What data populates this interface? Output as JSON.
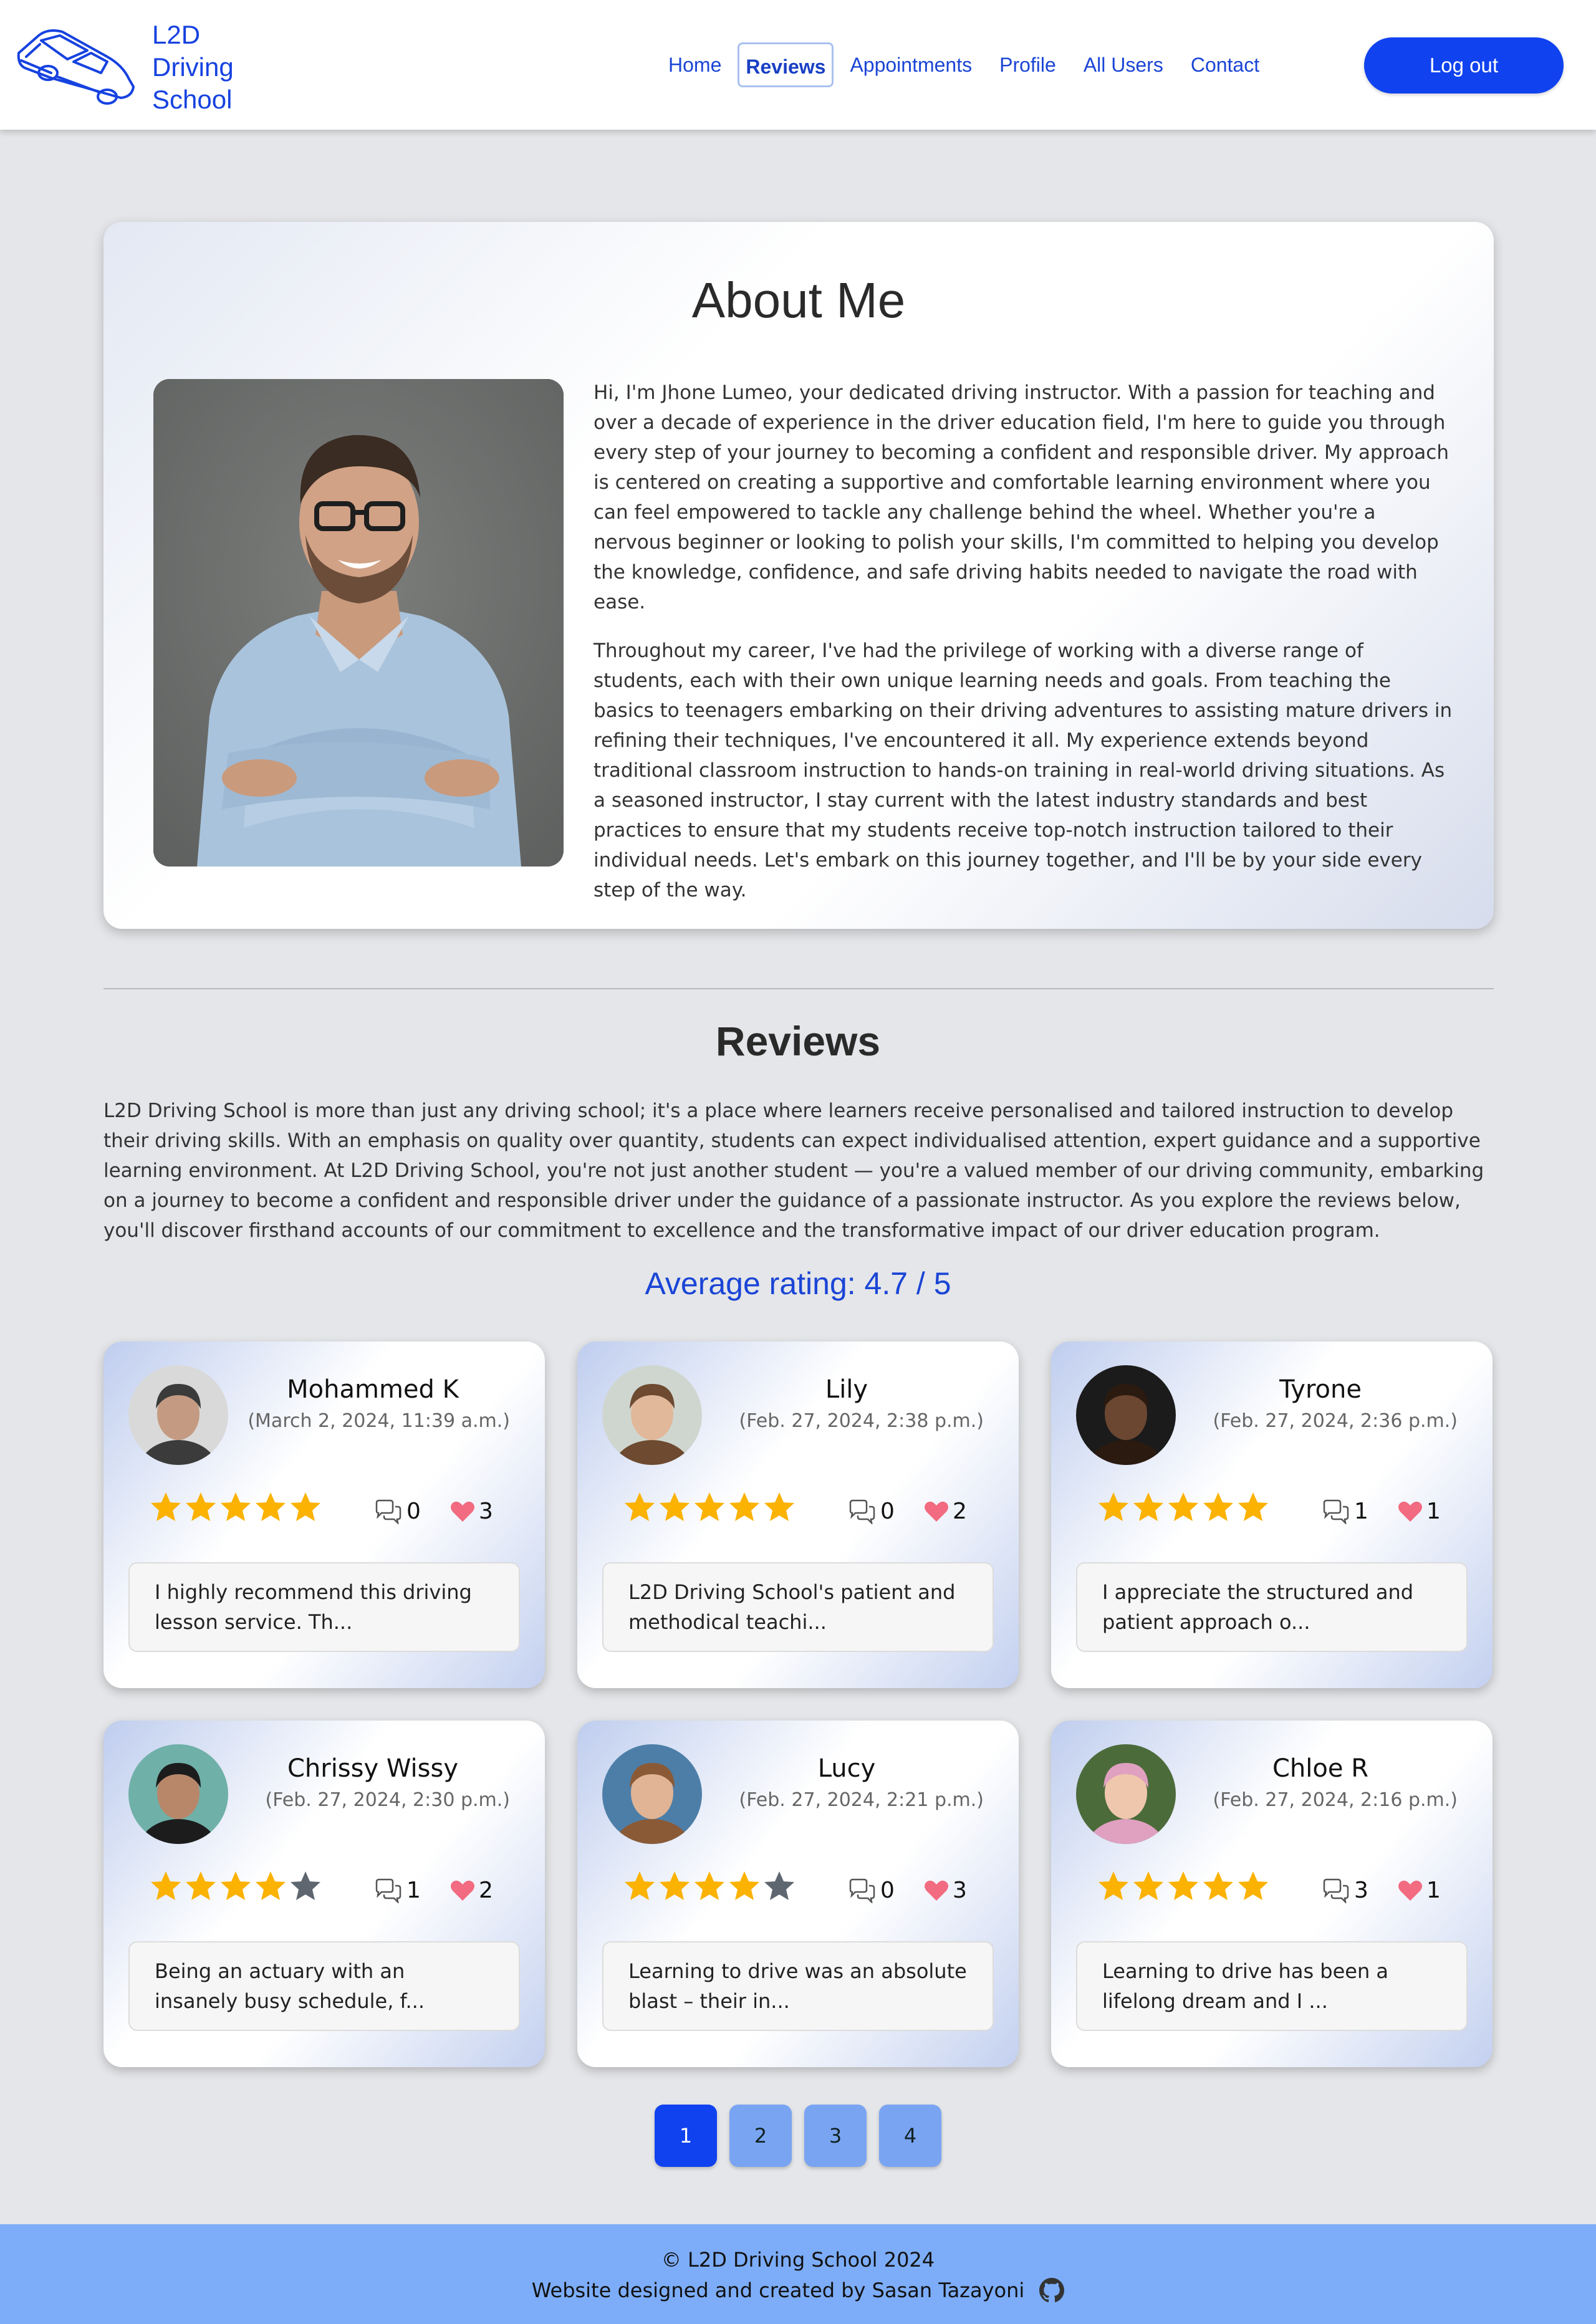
{
  "brand": {
    "line1": "L2D",
    "line2": "Driving",
    "line3": "School"
  },
  "nav": {
    "items": [
      {
        "label": "Home"
      },
      {
        "label": "Reviews"
      },
      {
        "label": "Appointments"
      },
      {
        "label": "Profile"
      },
      {
        "label": "All Users"
      },
      {
        "label": "Contact"
      }
    ],
    "logout_label": "Log out"
  },
  "about": {
    "title": "About Me",
    "paragraph1": "Hi, I'm Jhone Lumeo, your dedicated driving instructor. With a passion for teaching and over a decade of experience in the driver education field, I'm here to guide you through every step of your journey to becoming a confident and responsible driver. My approach is centered on creating a supportive and comfortable learning environment where you can feel empowered to tackle any challenge behind the wheel. Whether you're a nervous beginner or looking to polish your skills, I'm committed to helping you develop the knowledge, confidence, and safe driving habits needed to navigate the road with ease.",
    "paragraph2": "Throughout my career, I've had the privilege of working with a diverse range of students, each with their own unique learning needs and goals. From teaching the basics to teenagers embarking on their driving adventures to assisting mature drivers in refining their techniques, I've encountered it all. My experience extends beyond traditional classroom instruction to hands-on training in real-world driving situations. As a seasoned instructor, I stay current with the latest industry standards and best practices to ensure that my students receive top-notch instruction tailored to their individual needs. Let's embark on this journey together, and I'll be by your side every step of the way."
  },
  "reviews": {
    "title": "Reviews",
    "intro": "L2D Driving School is more than just any driving school; it's a place where learners receive personalised and tailored instruction to develop their driving skills. With an emphasis on quality over quantity, students can expect individualised attention, expert guidance and a supportive learning environment. At L2D Driving School, you're not just another student — you're a valued member of our driving community, embarking on a journey to become a confident and responsible driver under the guidance of a passionate instructor. As you explore the reviews below, you'll discover firsthand accounts of our commitment to excellence and the transformative impact of our driver education program.",
    "average": "Average rating: 4.7 / 5",
    "cards": [
      {
        "name": "Mohammed K",
        "date": "(March 2, 2024, 11:39 a.m.)",
        "rating": 5,
        "comments": "0",
        "likes": "3",
        "excerpt": "I highly recommend this driving lesson service. Th..."
      },
      {
        "name": "Lily",
        "date": "(Feb. 27, 2024, 2:38 p.m.)",
        "rating": 5,
        "comments": "0",
        "likes": "2",
        "excerpt": "L2D Driving School's patient and methodical teachi..."
      },
      {
        "name": "Tyrone",
        "date": "(Feb. 27, 2024, 2:36 p.m.)",
        "rating": 5,
        "comments": "1",
        "likes": "1",
        "excerpt": "I appreciate the structured and patient approach o..."
      },
      {
        "name": "Chrissy Wissy",
        "date": "(Feb. 27, 2024, 2:30 p.m.)",
        "rating": 4,
        "comments": "1",
        "likes": "2",
        "excerpt": "Being an actuary with an insanely busy schedule, f..."
      },
      {
        "name": "Lucy",
        "date": "(Feb. 27, 2024, 2:21 p.m.)",
        "rating": 4,
        "comments": "0",
        "likes": "3",
        "excerpt": "Learning to drive was an absolute blast – their in..."
      },
      {
        "name": "Chloe R",
        "date": "(Feb. 27, 2024, 2:16 p.m.)",
        "rating": 5,
        "comments": "3",
        "likes": "1",
        "excerpt": "Learning to drive has been a lifelong dream and I ..."
      }
    ]
  },
  "pagination": {
    "pages": [
      "1",
      "2",
      "3",
      "4"
    ],
    "current": "1"
  },
  "footer": {
    "copyright": "© L2D Driving School 2024",
    "credit": "Website designed and created by Sasan Tazayoni"
  },
  "colors": {
    "accent": "#1042f0",
    "link": "#1a45d6",
    "star_filled": "#fbb200",
    "star_empty": "#5e6670",
    "heart": "#f26b80",
    "footer_bg": "#7dadf8"
  },
  "icons": {
    "brand": "car-logo-icon",
    "comments": "comments-icon",
    "likes": "heart-icon",
    "github": "github-icon"
  }
}
